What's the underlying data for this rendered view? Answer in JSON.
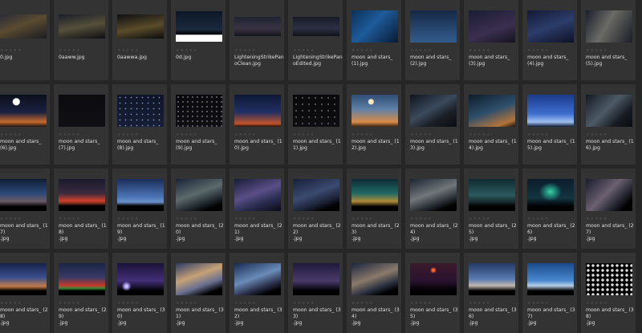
{
  "rating_glyph": "★",
  "star_color": "#4a4a4a",
  "tiles": [
    {
      "name": "0.jpg",
      "icon": "night-clouds-moon-thumbnail",
      "bg": "linear-gradient(160deg,#2a2b3a 0%,#5a4b30 45%,#1c1c22 100%)",
      "h": 30
    },
    {
      "name": "0aaww.jpg",
      "icon": "night-clouds-moon-thumbnail",
      "bg": "linear-gradient(170deg,#1b1e29 0%,#55503a 50%,#0d0e12 100%)",
      "h": 30
    },
    {
      "name": "0aawwa.jpg",
      "icon": "night-clouds-moon-thumbnail",
      "bg": "linear-gradient(170deg,#0e0f12 0%,#5a4c2a 55%,#0b0b0d 100%)",
      "h": 30
    },
    {
      "name": "0d.jpg",
      "icon": "night-mountains-thumbnail",
      "bg": "linear-gradient(180deg,#0c1626 0%,#1b2a3f 60%,#000 76%,#ffffff 78%,#ffffff 100%)",
      "h": 38
    },
    {
      "name": "LighteningStrikePanoClean.jpg",
      "icon": "lightning-panorama-thumbnail",
      "bg": "linear-gradient(180deg,#1f2330 0%,#3a3344 60%,#14151c 100%)",
      "h": 24
    },
    {
      "name": "LighteningStrikePanoEdited.jpg",
      "icon": "lightning-panorama-thumbnail",
      "bg": "linear-gradient(180deg,#181a26 0%,#2c3045 60%,#101118 100%)",
      "h": 24
    },
    {
      "name": "moon and stars_ (1).jpg",
      "icon": "milky-way-thumbnail",
      "bg": "linear-gradient(135deg,#0b3159 0%,#1e5b9a 45%,#071a33 100%)",
      "h": 40
    },
    {
      "name": "moon and stars_ (2).jpg",
      "icon": "star-trails-thumbnail",
      "bg": "linear-gradient(180deg,#152845 0%,#335d8c 100%)",
      "h": 40
    },
    {
      "name": "moon and stars_ (3).jpg",
      "icon": "starry-sky-thumbnail",
      "bg": "linear-gradient(160deg,#1a1c33 0%,#3b2f4f 60%,#14121f 100%)",
      "h": 40
    },
    {
      "name": "moon and stars_ (4).jpg",
      "icon": "milky-way-thumbnail",
      "bg": "linear-gradient(160deg,#121935 0%,#2c3d6b 50%,#0d1124 100%)",
      "h": 40
    },
    {
      "name": "moon and stars_ (5).jpg",
      "icon": "milky-way-thumbnail",
      "bg": "linear-gradient(120deg,#1c1f2a 0%,#6a6a66 45%,#1b1d24 100%)",
      "h": 40
    },
    {
      "name": "moon and stars_ (6).jpg",
      "icon": "moon-over-horizon-thumbnail",
      "bg": "radial-gradient(circle at 35% 22%,#ffffff 0,#ffffff 4px,transparent 5px),linear-gradient(180deg,#0b0f1c 0%,#1a2140 55%,#c86a2c 85%,#1b1510 100%)",
      "h": 40
    },
    {
      "name": "moon and stars_ (7).jpg",
      "icon": "dark-sky-thumbnail",
      "bg": "linear-gradient(180deg,#0b0b0e 0%,#111115 100%)",
      "h": 40
    },
    {
      "name": "moon and stars_ (8).jpg",
      "icon": "starry-sky-thumbnail",
      "bg": "radial-gradient(#8899cc 0.6px,transparent 1px) 0 0/7px 7px,linear-gradient(180deg,#0f1628 0%,#161f36 100%)",
      "h": 40
    },
    {
      "name": "moon and stars_ (9).jpg",
      "icon": "starry-sky-thumbnail",
      "bg": "radial-gradient(#aab 0.5px,transparent 1px) 0 0/6px 6px,linear-gradient(180deg,#0a0a0d 0%,#101013 100%)",
      "h": 40
    },
    {
      "name": "moon and stars_ (10).jpg",
      "icon": "twilight-sky-thumbnail",
      "bg": "linear-gradient(180deg,#0d1836 0%,#223064 55%,#c0542a 90%,#2a130b 100%)",
      "h": 40
    },
    {
      "name": "moon and stars_ (11).jpg",
      "icon": "starry-sky-thumbnail",
      "bg": "radial-gradient(#99a 0.5px,transparent 1px) 0 0/8px 8px,linear-gradient(180deg,#09090b 0%,#0f0f12 100%)",
      "h": 40
    },
    {
      "name": "moon and stars_ (12).jpg",
      "icon": "crescent-moon-thumbnail",
      "bg": "radial-gradient(circle at 42% 22%,#f4e6c0 0,#f4e6c0 3px,transparent 4px),linear-gradient(180deg,#2f4d75 0%,#5e7fa6 45%,#d98c48 85%,#3a2414 100%)",
      "h": 40
    },
    {
      "name": "moon and stars_ (13).jpg",
      "icon": "milky-way-thumbnail",
      "bg": "linear-gradient(150deg,#0f1420 0%,#3a4a5c 45%,#1a1e26 70%,#0b0c10 100%)",
      "h": 40
    },
    {
      "name": "moon and stars_ (14).jpg",
      "icon": "comet-sky-thumbnail",
      "bg": "linear-gradient(160deg,#0e1c2c 0%,#2e4f6a 50%,#b2743a 85%,#1a130d 100%)",
      "h": 40
    },
    {
      "name": "moon and stars_ (15).jpg",
      "icon": "blue-dusk-thumbnail",
      "bg": "linear-gradient(180deg,#1a3a8a 0%,#3f6fd1 60%,#9fc0f0 85%,#0e1a33 100%)",
      "h": 40
    },
    {
      "name": "moon and stars_ (16).jpg",
      "icon": "milky-way-thumbnail",
      "bg": "linear-gradient(135deg,#141a24 0%,#4d5a66 45%,#161b22 75%,#0b0c0f 100%)",
      "h": 40
    },
    {
      "name": "moon and stars_ (17)\n.jpg",
      "icon": "milky-way-panorama-thumbnail",
      "bg": "linear-gradient(180deg,#0f1d33 0%,#2d4a7a 45%,#6b5a66 70%,#000 86%,#000 100%)",
      "h": 40
    },
    {
      "name": "moon and stars_ (18)\n.jpg",
      "icon": "aurora-horizon-thumbnail",
      "bg": "linear-gradient(180deg,#1a1a2c 0%,#3a2a40 45%,#d0402a 68%,#7a2c1c 76%,#000 84%,#000 100%)",
      "h": 40
    },
    {
      "name": "moon and stars_ (19)\n.jpg",
      "icon": "blue-night-thumbnail",
      "bg": "linear-gradient(180deg,#1b2e58 0%,#4a73b4 55%,#6b8fc8 72%,#000 84%,#000 100%)",
      "h": 40
    },
    {
      "name": "moon and stars_ (20)\n.jpg",
      "icon": "milky-way-panorama-thumbnail",
      "bg": "linear-gradient(160deg,#1a2438 0%,#5c6a6c 45%,#222a30 70%,#000 86%,#000 100%)",
      "h": 40
    },
    {
      "name": "moon and stars_ (21)\n.jpg",
      "icon": "milky-way-thumbnail",
      "bg": "linear-gradient(160deg,#1a1c38 0%,#5a4f86 45%,#2a2d52 70%,#0a0a14 100%)",
      "h": 40
    },
    {
      "name": "moon and stars_ (22)\n.jpg",
      "icon": "milky-way-thumbnail",
      "bg": "linear-gradient(160deg,#18203a 0%,#3b4a70 45%,#1c2238 70%,#000 86%,#000 100%)",
      "h": 40
    },
    {
      "name": "moon and stars_ (23)\n.jpg",
      "icon": "aurora-sky-thumbnail",
      "bg": "linear-gradient(180deg,#0d2a33 0%,#1f6a66 45%,#b08a3a 70%,#000 86%,#000 100%)",
      "h": 40
    },
    {
      "name": "moon and stars_ (24)\n.jpg",
      "icon": "milky-way-panorama-thumbnail",
      "bg": "linear-gradient(160deg,#1a2434 0%,#70777a 45%,#2a2f36 70%,#000 86%,#000 100%)",
      "h": 40
    },
    {
      "name": "moon and stars_ (25)\n.jpg",
      "icon": "teal-sky-thumbnail",
      "bg": "linear-gradient(180deg,#0f2a30 0%,#2a5a5e 50%,#16282c 72%,#000 86%,#000 100%)",
      "h": 40
    },
    {
      "name": "moon and stars_ (26)\n.jpg",
      "icon": "green-aurora-thumbnail",
      "bg": "radial-gradient(ellipse at 50% 40%,#3fd0a8 0,#1f8a7a 6px,transparent 14px),linear-gradient(180deg,#0c1c2c 0%,#123440 60%,#000 86%,#000 100%)",
      "h": 40
    },
    {
      "name": "moon and stars_ (27)\n.jpg",
      "icon": "milky-way-thumbnail",
      "bg": "linear-gradient(135deg,#1a1c2a 0%,#6a6070 45%,#262632 70%,#000 86%,#000 100%)",
      "h": 40
    },
    {
      "name": "moon and stars_ (28)\n.jpg",
      "icon": "milky-way-arc-thumbnail",
      "bg": "linear-gradient(180deg,#16224a 0%,#3b4f8e 45%,#c07a4a 72%,#000 86%,#000 100%)",
      "h": 40
    },
    {
      "name": "moon and stars_ (29)\n.jpg",
      "icon": "aurora-horizon-thumbnail",
      "bg": "linear-gradient(180deg,#1a2446 0%,#3a3a66 45%,#c83a2a 70%,#3a8a3a 78%,#000 86%,#000 100%)",
      "h": 40
    },
    {
      "name": "moon and stars_ (30)\n.jpg",
      "icon": "purple-night-thumbnail",
      "bg": "radial-gradient(circle at 20% 72%,#e6e0ff 0,#b8a8ff 2px,transparent 6px),linear-gradient(180deg,#1a1238 0%,#43307a 55%,#000 86%,#000 100%)",
      "h": 40
    },
    {
      "name": "moon and stars_ (31)\n.jpg",
      "icon": "cloudy-sky-thumbnail",
      "bg": "linear-gradient(160deg,#2a3a66 0%,#c6a276 40%,#6a7090 65%,#000 86%,#000 100%)",
      "h": 40
    },
    {
      "name": "moon and stars_ (32)\n.jpg",
      "icon": "milky-way-thumbnail",
      "bg": "linear-gradient(160deg,#182a52 0%,#6a8cb8 45%,#2a2f4a 70%,#000 86%,#000 100%)",
      "h": 40
    },
    {
      "name": "moon and stars_ (33)\n.jpg",
      "icon": "violet-sky-thumbnail",
      "bg": "linear-gradient(180deg,#1f1a3a 0%,#4a3a6a 55%,#000 86%,#000 100%)",
      "h": 40
    },
    {
      "name": "moon and stars_ (34)\n.jpg",
      "icon": "milky-way-thumbnail",
      "bg": "linear-gradient(160deg,#1a2440 0%,#8a7a6a 45%,#2a2f40 70%,#000 86%,#000 100%)",
      "h": 40
    },
    {
      "name": "moon and stars_ (35)\n.jpg",
      "icon": "red-moon-thumbnail",
      "bg": "radial-gradient(circle at 50% 22%,#ff8a3a 0,#e0502a 2px,transparent 4px),linear-gradient(180deg,#3a1a2a 0%,#2a1230 55%,#000 86%,#000 100%)",
      "h": 40
    },
    {
      "name": "moon and stars_ (36)\n.jpg",
      "icon": "dusk-sky-thumbnail",
      "bg": "linear-gradient(180deg,#243a66 0%,#5a7ab0 50%,#c0b8b0 70%,#000 86%,#000 100%)",
      "h": 40
    },
    {
      "name": "moon and stars_ (37)\n.jpg",
      "icon": "blue-hour-thumbnail",
      "bg": "linear-gradient(180deg,#1a4a8a 0%,#4a8ad0 55%,#b8d0e8 70%,#000 86%,#000 100%)",
      "h": 40
    },
    {
      "name": "moon and stars_ (38)\n.jpg",
      "icon": "moon-phases-thumbnail",
      "bg": "radial-gradient(circle,#ddd 0,#ddd 1.5px,transparent 2px) 0 0/6px 6px,linear-gradient(180deg,#000 0%,#050505 100%)",
      "h": 40
    }
  ]
}
